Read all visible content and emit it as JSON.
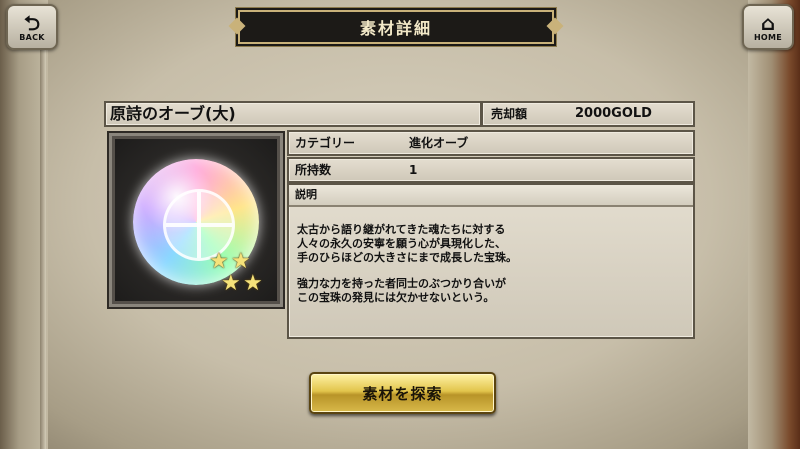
{
  "nav": {
    "back_label": "BACK",
    "home_label": "HOME"
  },
  "header": {
    "title": "素材詳細"
  },
  "item": {
    "name": "原詩のオーブ(大)",
    "price_label": "売却額",
    "price_value": "2000GOLD",
    "rarity_stars": 4,
    "category_label": "カテゴリー",
    "category_value": "進化オーブ",
    "owned_label": "所持数",
    "owned_value": "1",
    "description_label": "説明",
    "description_p1": "太古から語り継がれてきた魂たちに対する\n人々の永久の安寧を願う心が具現化した、\n手のひらほどの大きさにまで成長した宝珠。",
    "description_p2": "強力な力を持った者同士のぶつかり合いが\nこの宝珠の発見には欠かせないという。"
  },
  "actions": {
    "search_button": "素材を探索"
  },
  "icons": {
    "back": "back-arrow-icon",
    "home": "home-icon",
    "star": "star-icon"
  }
}
